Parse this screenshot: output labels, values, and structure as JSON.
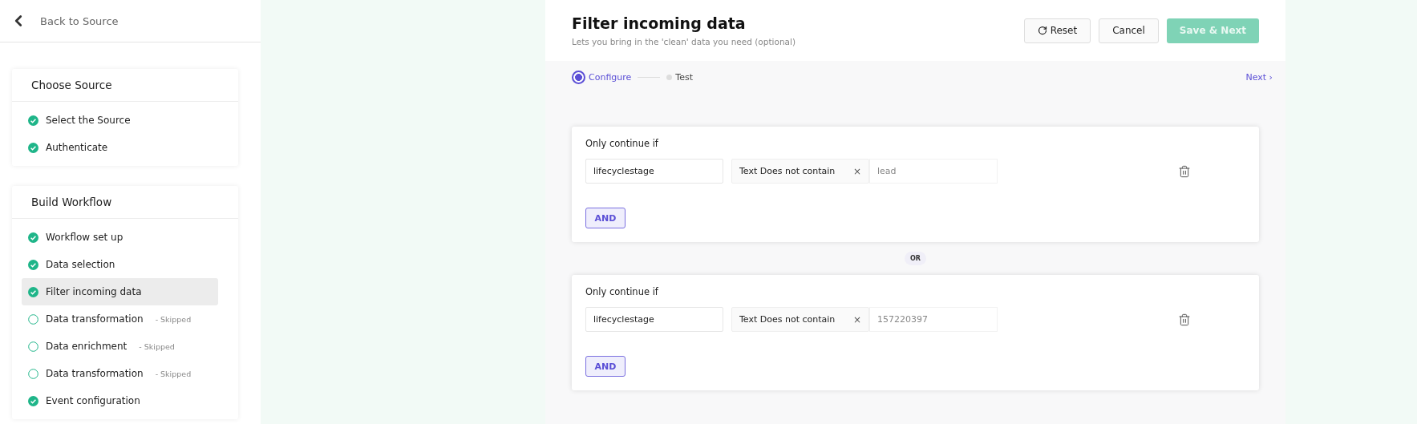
{
  "sidebar": {
    "back_link": "Back to Source",
    "sections": [
      {
        "title": "Choose Source",
        "items": [
          {
            "label": "Select the Source",
            "done": true,
            "selected": false
          },
          {
            "label": "Authenticate",
            "done": true,
            "selected": false
          }
        ]
      },
      {
        "title": "Build Workflow",
        "items": [
          {
            "label": "Workflow set up",
            "done": true,
            "selected": false
          },
          {
            "label": "Data selection",
            "done": true,
            "selected": false
          },
          {
            "label": "Filter incoming data",
            "done": true,
            "selected": true
          },
          {
            "label": "Data transformation",
            "done": false,
            "selected": false,
            "note": "- Skipped"
          },
          {
            "label": "Data enrichment",
            "done": false,
            "selected": false,
            "note": "- Skipped"
          },
          {
            "label": "Data transformation",
            "done": false,
            "selected": false,
            "note": "- Skipped"
          },
          {
            "label": "Event configuration",
            "done": true,
            "selected": false
          }
        ]
      }
    ]
  },
  "header": {
    "title": "Filter incoming data",
    "subtitle": "Lets you bring in the 'clean' data you need (optional)",
    "buttons": [
      {
        "label": "Reset",
        "kind": "reset",
        "disabled": false
      },
      {
        "label": "Cancel",
        "kind": "plain",
        "disabled": false
      },
      {
        "label": "Save & Next",
        "kind": "primary",
        "disabled": true
      }
    ]
  },
  "steps": {
    "items": [
      {
        "label": "Configure",
        "selected": true
      },
      {
        "label": "Test",
        "selected": false
      }
    ],
    "next": "Next ›"
  },
  "filter_groups": [
    {
      "title": "Only continue if",
      "conditions": [
        {
          "field": "lifecyclestage",
          "operator": "Text Does not contain",
          "clear": "×",
          "value": "lead"
        }
      ],
      "and_button": "AND"
    },
    {
      "title": "Only continue if",
      "conditions": [
        {
          "field": "lifecyclestage",
          "operator": "Text Does not contain",
          "clear": "×",
          "value": "157220397"
        }
      ],
      "and_button": "AND"
    }
  ],
  "separator": "OR"
}
